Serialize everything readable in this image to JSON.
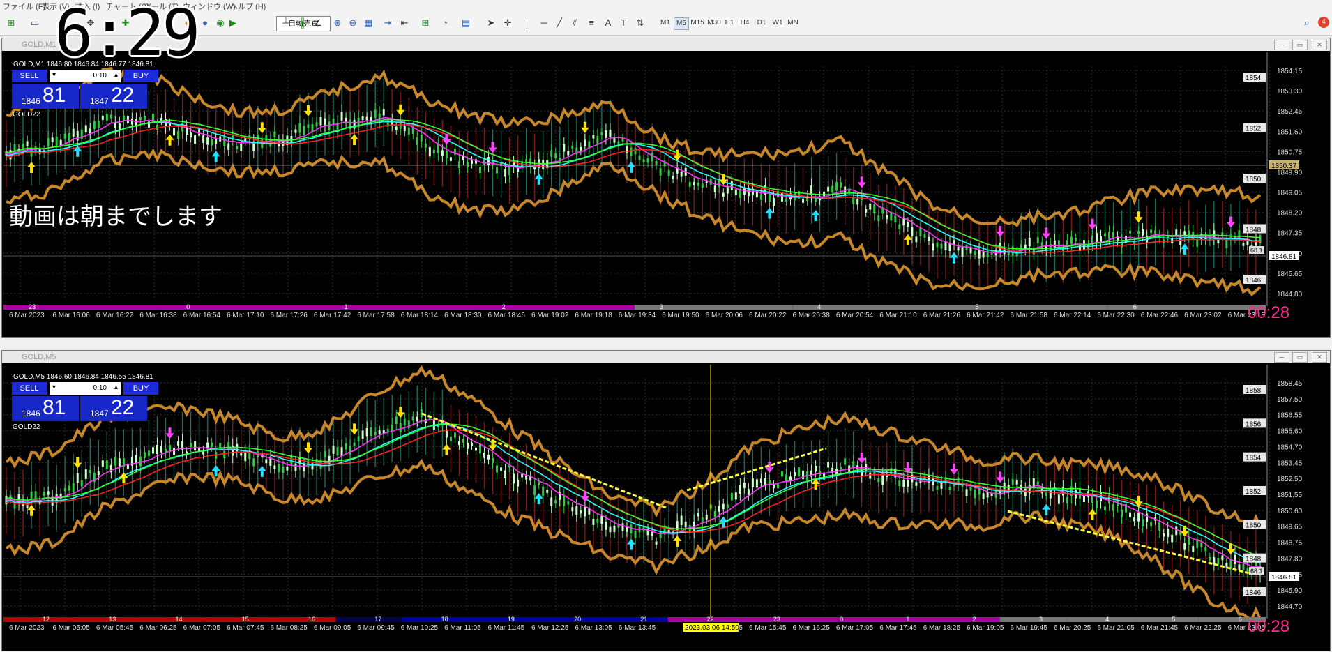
{
  "menu": [
    "ファイル (F)",
    "表示 (V)",
    "挿入 (I)",
    "チャート (C)",
    "ツール (T)",
    "ウィンドウ (W)",
    "ヘルプ (H)"
  ],
  "toolbar": {
    "autotrade_label": "自動売買",
    "timeframes": [
      "M1",
      "M5",
      "M15",
      "M30",
      "H1",
      "H4",
      "D1",
      "W1",
      "MN"
    ],
    "active_timeframe": "M5",
    "notification_count": "4"
  },
  "overlay": {
    "clock": "6:29"
  },
  "charts": [
    {
      "window_title": "GOLD,M1",
      "header": "GOLD,M1  1846.80 1846.84 1846.77 1846.81",
      "indicator": "GOLD22",
      "sell_label": "SELL",
      "buy_label": "BUY",
      "lot": "0.10",
      "sell_small": "1846",
      "sell_big": "81",
      "buy_small": "1847",
      "buy_big": "22",
      "overlay_text": "動画は朝までします",
      "timer": "00:28",
      "price_axis": [
        "1854.15",
        "1853.30",
        "1852.45",
        "1851.60",
        "1850.75",
        "1849.90",
        "1849.05",
        "1848.20",
        "1847.35",
        "1846.50",
        "1845.65",
        "1844.80"
      ],
      "price_tags": [
        "1854",
        "1852",
        "1850",
        "1848",
        "1846"
      ],
      "current_price": "1846.81",
      "line_price": "1850.37",
      "line_tag": "68.1",
      "session_numbers": [
        "23",
        "0",
        "1",
        "2",
        "3",
        "4",
        "5",
        "6"
      ],
      "time_axis": [
        "6 Mar 2023",
        "6 Mar 16:06",
        "6 Mar 16:22",
        "6 Mar 16:38",
        "6 Mar 16:54",
        "6 Mar 17:10",
        "6 Mar 17:26",
        "6 Mar 17:42",
        "6 Mar 17:58",
        "6 Mar 18:14",
        "6 Mar 18:30",
        "6 Mar 18:46",
        "6 Mar 19:02",
        "6 Mar 19:18",
        "6 Mar 19:34",
        "6 Mar 19:50",
        "6 Mar 20:06",
        "6 Mar 20:22",
        "6 Mar 20:38",
        "6 Mar 20:54",
        "6 Mar 21:10",
        "6 Mar 21:26",
        "6 Mar 21:42",
        "6 Mar 21:58",
        "6 Mar 22:14",
        "6 Mar 22:30",
        "6 Mar 22:46",
        "6 Mar 23:02",
        "6 Mar 23:18"
      ]
    },
    {
      "window_title": "GOLD,M5",
      "header": "GOLD,M5  1846.60 1846.84 1846.55 1846.81",
      "indicator": "GOLD22",
      "sell_label": "SELL",
      "buy_label": "BUY",
      "lot": "0.10",
      "sell_small": "1846",
      "sell_big": "81",
      "buy_small": "1847",
      "buy_big": "22",
      "timer": "00:28",
      "price_axis": [
        "1858.45",
        "1857.50",
        "1856.55",
        "1855.60",
        "1854.70",
        "1853.45",
        "1852.50",
        "1851.55",
        "1850.60",
        "1849.65",
        "1848.75",
        "1847.80",
        "1846.85",
        "1845.90",
        "1844.70"
      ],
      "price_tags": [
        "1858",
        "1856",
        "1854",
        "1852",
        "1850",
        "1848",
        "1846"
      ],
      "current_price": "1846.81",
      "line_tag": "68.1",
      "session_numbers": [
        "12",
        "13",
        "14",
        "15",
        "16",
        "17",
        "18",
        "19",
        "20",
        "21",
        "22",
        "23",
        "0",
        "1",
        "2",
        "3",
        "4",
        "5",
        "6"
      ],
      "cursor_time": "2023.03.06 14:50",
      "time_axis": [
        "6 Mar 2023",
        "6 Mar 05:05",
        "6 Mar 05:45",
        "6 Mar 06:25",
        "6 Mar 07:05",
        "6 Mar 07:45",
        "6 Mar 08:25",
        "6 Mar 09:05",
        "6 Mar 09:45",
        "6 Mar 10:25",
        "6 Mar 11:05",
        "6 Mar 11:45",
        "6 Mar 12:25",
        "6 Mar 13:05",
        "6 Mar 13:45",
        "",
        "6 Mar 15:05",
        "6 Mar 15:45",
        "6 Mar 16:25",
        "6 Mar 17:05",
        "6 Mar 17:45",
        "6 Mar 18:25",
        "6 Mar 19:05",
        "6 Mar 19:45",
        "6 Mar 20:25",
        "6 Mar 21:05",
        "6 Mar 21:45",
        "6 Mar 22:25",
        "6 Mar 23:05"
      ]
    }
  ]
}
